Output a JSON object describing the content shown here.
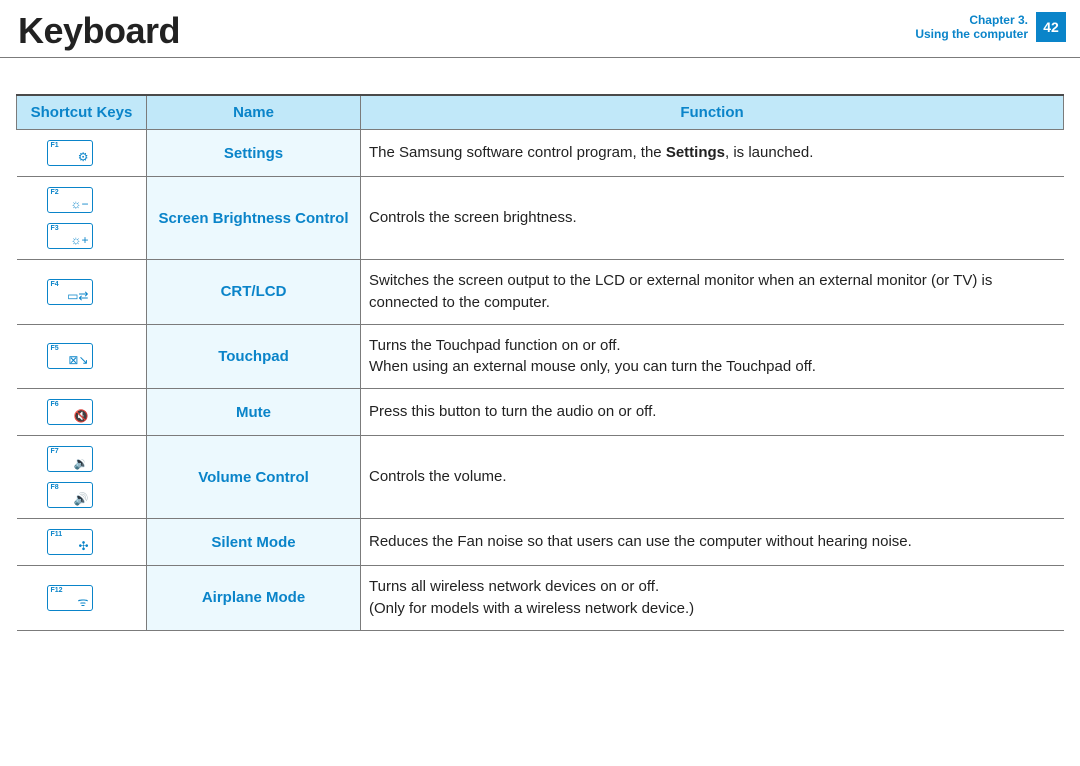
{
  "header": {
    "title": "Keyboard",
    "chapter_line1": "Chapter 3.",
    "chapter_line2": "Using the computer",
    "page_number": "42"
  },
  "table": {
    "headers": {
      "keys": "Shortcut Keys",
      "name": "Name",
      "function": "Function"
    },
    "rows": [
      {
        "keys": [
          {
            "label": "F1",
            "icon": "⚙"
          }
        ],
        "name": "Settings",
        "function_html": "The Samsung software control program, the <b>Settings</b>, is launched."
      },
      {
        "keys": [
          {
            "label": "F2",
            "icon": "☼−"
          },
          {
            "label": "F3",
            "icon": "☼+"
          }
        ],
        "name": "Screen Brightness Control",
        "function_html": "Controls the screen brightness."
      },
      {
        "keys": [
          {
            "label": "F4",
            "icon": "▭⇄"
          }
        ],
        "name": "CRT/LCD",
        "function_html": "Switches the screen output to the LCD or external monitor when an external monitor (or TV) is connected to the computer."
      },
      {
        "keys": [
          {
            "label": "F5",
            "icon": "⊠↘"
          }
        ],
        "name": "Touchpad",
        "function_html": "Turns the Touchpad function on or off.<br>When using an external mouse only, you can turn the Touchpad off."
      },
      {
        "keys": [
          {
            "label": "F6",
            "icon": "🔇"
          }
        ],
        "name": "Mute",
        "function_html": "Press this button to turn the audio on or off."
      },
      {
        "keys": [
          {
            "label": "F7",
            "icon": "🔉"
          },
          {
            "label": "F8",
            "icon": "🔊"
          }
        ],
        "name": "Volume Control",
        "function_html": "Controls the volume."
      },
      {
        "keys": [
          {
            "label": "F11",
            "icon": "✣"
          }
        ],
        "name": "Silent Mode",
        "function_html": "Reduces the Fan noise so that users can use the computer without hearing noise."
      },
      {
        "keys": [
          {
            "label": "F12",
            "icon": "ᯤ"
          }
        ],
        "name": "Airplane Mode",
        "function_html": "Turns all wireless network devices on or off.<br>(Only for models with a wireless network device.)"
      }
    ]
  }
}
